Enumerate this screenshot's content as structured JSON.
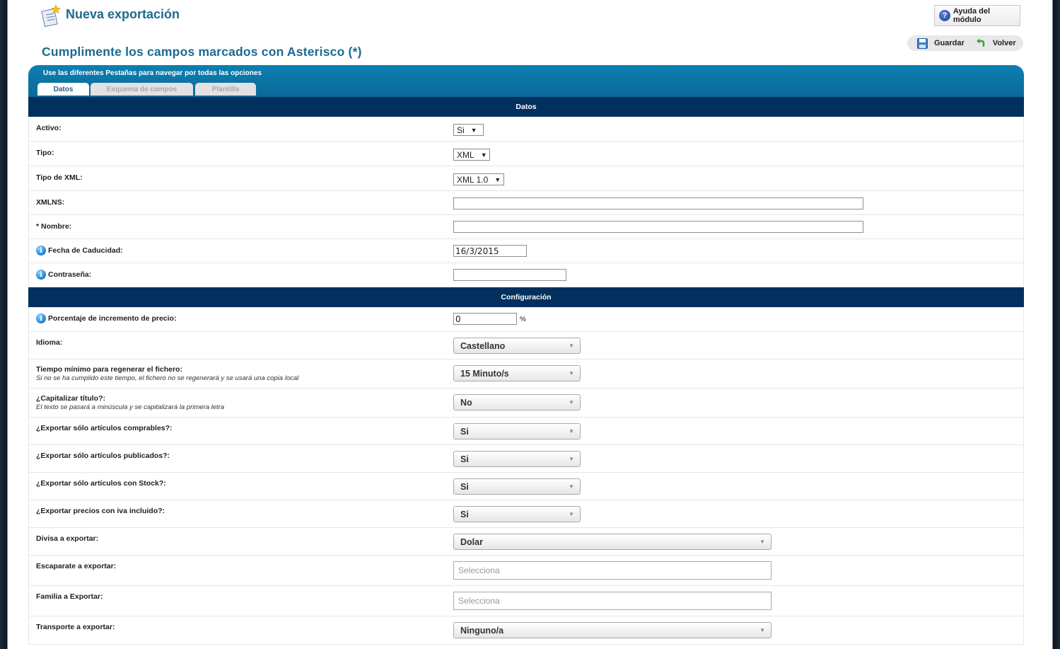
{
  "header": {
    "title": "Nueva exportación",
    "help_label": "Ayuda del módulo",
    "save_label": "Guardar",
    "back_label": "Volver"
  },
  "subtitle": "Cumplimente los campos marcados con Asterisco (*)",
  "tabs": {
    "hint": "Use las diferentes Pestañas para navegar por todas las opciones",
    "items": [
      {
        "label": "Datos",
        "active": true
      },
      {
        "label": "Esquema de campos",
        "active": false
      },
      {
        "label": "Plantilla",
        "active": false
      }
    ]
  },
  "sections": {
    "datos": "Datos",
    "config": "Configuración"
  },
  "fields": {
    "activo": {
      "label": "Activo:",
      "value": "Si"
    },
    "tipo": {
      "label": "Tipo:",
      "value": "XML"
    },
    "tipo_xml": {
      "label": "Tipo de XML:",
      "value": "XML 1.0"
    },
    "xmlns": {
      "label": "XMLNS:",
      "value": ""
    },
    "nombre": {
      "label": "* Nombre:",
      "value": ""
    },
    "fecha": {
      "label": "Fecha de Caducidad:",
      "value": "16/3/2015"
    },
    "contrasena": {
      "label": "Contraseña:",
      "value": ""
    },
    "porcentaje": {
      "label": "Porcentaje de incremento de precio:",
      "value": "0",
      "unit": "%"
    },
    "idioma": {
      "label": "Idioma:",
      "value": "Castellano"
    },
    "tiempo": {
      "label": "Tiempo mínimo para regenerar el fichero:",
      "hint": "Si no se ha cumplido este tiempo, el fichero no se regenerará y se usará una copia local",
      "value": "15 Minuto/s"
    },
    "capitalizar": {
      "label": "¿Capitalizar título?:",
      "hint": "El texto se pasará a minúscula y se capitalizará la primera letra",
      "value": "No"
    },
    "comprables": {
      "label": "¿Exportar sólo artículos comprables?:",
      "value": "Si"
    },
    "publicados": {
      "label": "¿Exportar sólo artículos publicados?:",
      "value": "Si"
    },
    "stock": {
      "label": "¿Exportar sólo artículos con Stock?:",
      "value": "Si"
    },
    "iva": {
      "label": "¿Exportar precios con iva incluido?:",
      "value": "Si"
    },
    "divisa": {
      "label": "Divisa a exportar:",
      "value": "Dolar"
    },
    "escaparate": {
      "label": "Escaparate a exportar:",
      "placeholder": "Selecciona"
    },
    "familia": {
      "label": "Familia a Exportar:",
      "placeholder": "Selecciona"
    },
    "transporte": {
      "label": "Transporte a exportar:",
      "value": "Ninguno/a"
    }
  }
}
